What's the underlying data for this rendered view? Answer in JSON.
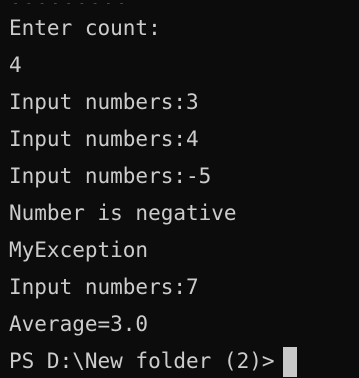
{
  "terminal": {
    "partial_top_text": "..........",
    "lines": [
      "Enter count:",
      "4",
      "Input numbers:3",
      "Input numbers:4",
      "Input numbers:-5",
      "Number is negative",
      "MyException",
      "Input numbers:7",
      "Average=3.0"
    ],
    "prompt": "PS D:\\New folder (2)>"
  }
}
